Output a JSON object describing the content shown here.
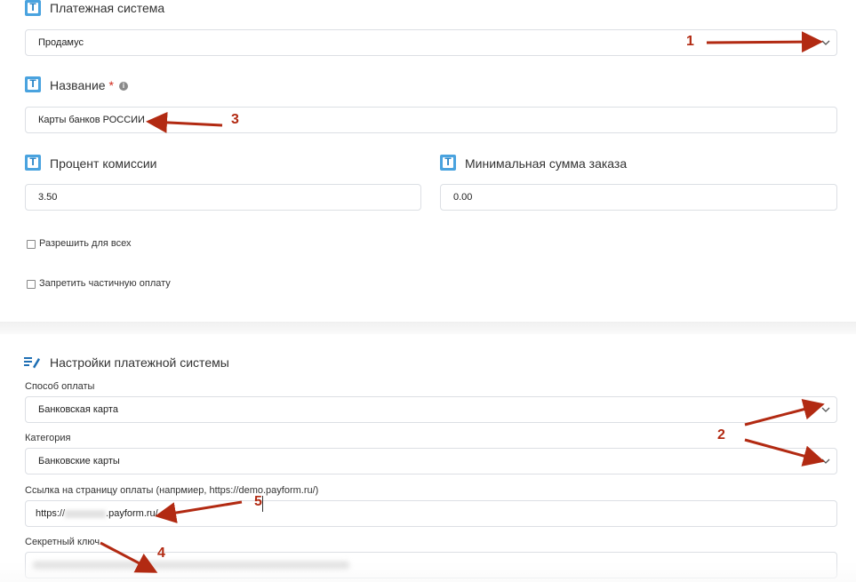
{
  "payment_system": {
    "label": "Платежная система",
    "value": "Продамус"
  },
  "name": {
    "label": "Название",
    "required_mark": "*",
    "info_glyph": "i",
    "value": "Карты банков РОССИИ"
  },
  "commission": {
    "label": "Процент комиссии",
    "value": "3.50"
  },
  "min_order": {
    "label": "Минимальная сумма заказа",
    "value": "0.00"
  },
  "checkboxes": {
    "allow_all": {
      "label": "Разрешить для всех",
      "checked": false
    },
    "forbid_partial": {
      "label": "Запретить частичную оплату",
      "checked": false
    }
  },
  "settings_section": {
    "title": "Настройки платежной системы"
  },
  "payment_method": {
    "label": "Способ оплаты",
    "value": "Банковская карта"
  },
  "category": {
    "label": "Категория",
    "value": "Банковские карты"
  },
  "payment_link": {
    "label": "Ссылка на страницу оплаты (напрмиер, https://demo.payform.ru/)",
    "value_prefix": "https://",
    "value_suffix": ".payform.ru/"
  },
  "secret_key": {
    "label": "Секретный ключ"
  },
  "annotations": {
    "n1": "1",
    "n2": "2",
    "n3": "3",
    "n4": "4",
    "n5": "5",
    "color": "#b22a12"
  },
  "icons": {
    "field_type": "T",
    "settings": "edit-list-icon"
  }
}
